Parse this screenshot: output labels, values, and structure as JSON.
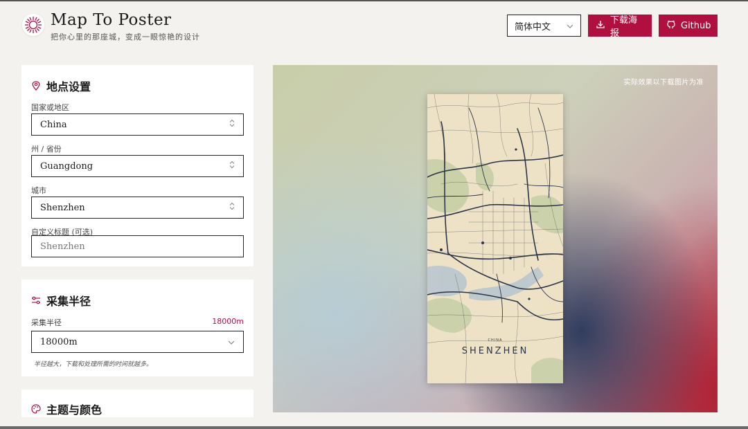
{
  "header": {
    "title": "Map To Poster",
    "subtitle": "把你心里的那座城，变成一眼惊艳的设计",
    "language": "简体中文",
    "download_label": "下载海报",
    "github_label": "Github"
  },
  "location": {
    "title": "地点设置",
    "country_label": "国家或地区",
    "country_value": "China",
    "state_label": "州 / 省份",
    "state_value": "Guangdong",
    "city_label": "城市",
    "city_value": "Shenzhen",
    "custom_title_label": "自定义标题 (可选)",
    "custom_title_placeholder": "Shenzhen"
  },
  "radius": {
    "title": "采集半径",
    "label": "采集半径",
    "value_display": "18000m",
    "select_value": "18000m",
    "hint": "半径越大，下载和处理所需的时间就越多。"
  },
  "theme": {
    "title": "主题与颜色"
  },
  "preview": {
    "note": "实际效果以下载图片为准",
    "poster_country": "CHINA",
    "poster_city": "SHENZHEN"
  },
  "colors": {
    "accent": "#b0103f",
    "poster_bg": "#ede2c5",
    "road": "#2b3448"
  }
}
